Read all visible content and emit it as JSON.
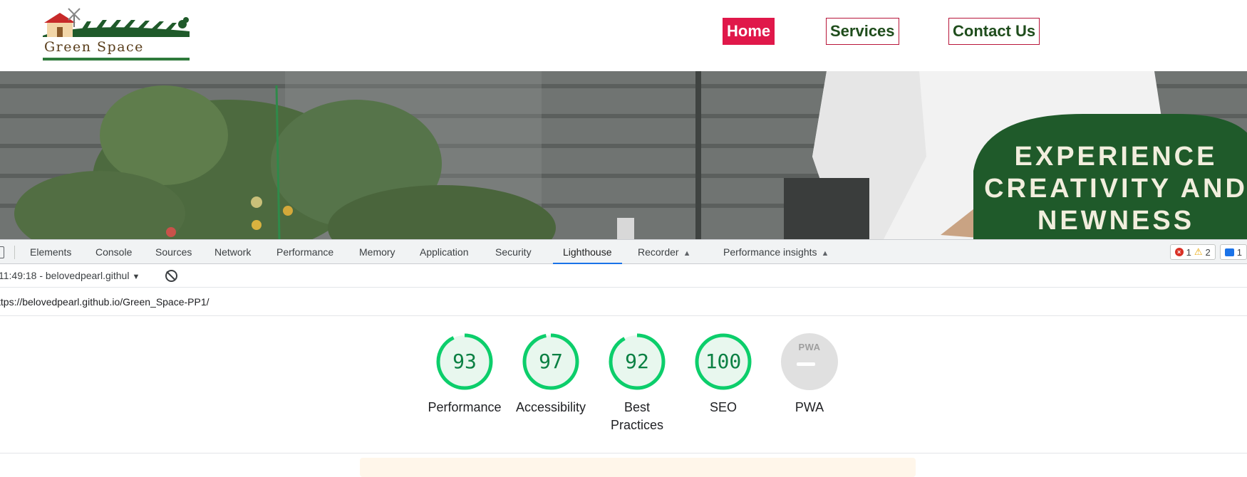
{
  "site": {
    "logo_text": "Green Space",
    "nav": [
      {
        "label": "Home",
        "active": true
      },
      {
        "label": "Services",
        "active": false
      },
      {
        "label": "Contact Us",
        "active": false
      }
    ],
    "hero_title": "EXPERIENCE\nCREATIVITY AND\nNEWNESS",
    "colors": {
      "nav_active_bg": "#e0184a",
      "nav_text": "#1f4d1c",
      "hero_banner": "#1f5a2a",
      "logo_green": "#2f7a3b"
    }
  },
  "devtools": {
    "tabs": [
      {
        "label": "Elements"
      },
      {
        "label": "Console"
      },
      {
        "label": "Sources"
      },
      {
        "label": "Network"
      },
      {
        "label": "Performance"
      },
      {
        "label": "Memory"
      },
      {
        "label": "Application"
      },
      {
        "label": "Security"
      },
      {
        "label": "Lighthouse",
        "active": true
      },
      {
        "label": "Recorder",
        "experimental_icon": "flask-icon"
      },
      {
        "label": "Performance insights",
        "experimental_icon": "flask-icon"
      }
    ],
    "issues": {
      "errors": "1",
      "warnings": "2",
      "messages": "1"
    },
    "report_select": "11:49:18 - belovedpearl.githul",
    "url": "ttps://belovedpearl.github.io/Green_Space-PP1/",
    "accent": "#1a73e8"
  },
  "lighthouse": {
    "scores": [
      {
        "label": "Performance",
        "score": "93"
      },
      {
        "label": "Accessibility",
        "score": "97"
      },
      {
        "label": "Best\nPractices",
        "score": "92"
      },
      {
        "label": "SEO",
        "score": "100"
      },
      {
        "label": "PWA",
        "score": "",
        "badge_text": "PWA"
      }
    ],
    "colors": {
      "pass": "#0cce6b",
      "pass_fill": "#e8f7ee",
      "pass_text": "#0b8043",
      "na": "#e0e0e0"
    }
  }
}
